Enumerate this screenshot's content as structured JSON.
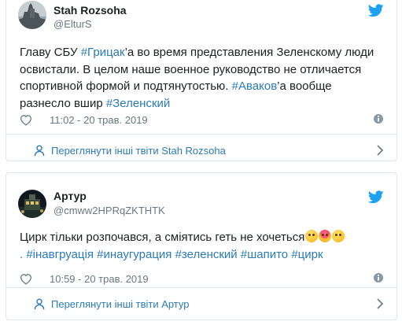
{
  "tweets": [
    {
      "name": "Stah Rozsoha",
      "handle": "@ElturS",
      "text_parts": {
        "p1": "Главу СБУ ",
        "tag1": "#Грицак",
        "p2": "’а во время представления Зеленскому люди освистали. В целом наше военное руководство не отличается спортивной формой и подтянутостью. ",
        "tag2": "#Аваков",
        "p3": "’а вообще разнесло вшир ",
        "tag3": "#Зеленский"
      },
      "timestamp": "11:02 - 20 трав. 2019",
      "footer_label": "Переглянути інші твіти Stah Rozsoha"
    },
    {
      "name": "Артур",
      "handle": "@cmww2HPRqZKTHTK",
      "text_parts": {
        "p1": "Цирк тільки розпочався, а сміятись геть не хочеться",
        "p2": ". ",
        "tags": [
          "#інавгруація",
          "#инаугурация",
          "#зеленский",
          "#шапито",
          "#цирк"
        ]
      },
      "emojis": [
        "worried-face-emoji",
        "exploding-head-emoji",
        "face-with-hand-over-mouth-emoji"
      ],
      "timestamp": "10:59 - 20 трав. 2019",
      "footer_label": "Переглянути інші твіти Артур"
    }
  ],
  "icons": {
    "heart": "heart-icon",
    "info": "info-icon",
    "bird": "twitter-bird-icon",
    "person": "person-icon",
    "chevron": "chevron-right-icon"
  },
  "colors": {
    "link": "#2b7bb9",
    "muted": "#697882",
    "border": "#e1e8ed",
    "twitter_blue": "#1da1f2"
  }
}
